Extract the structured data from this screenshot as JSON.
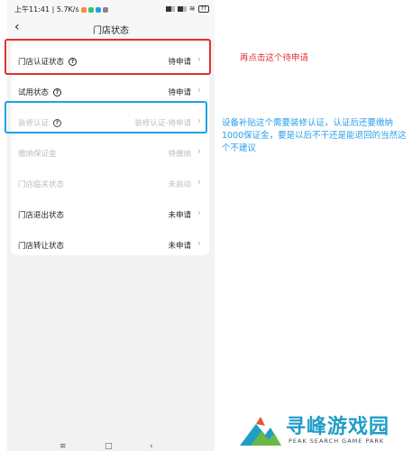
{
  "statusbar": {
    "time_speed": "上午11:41 | 5.7K/s",
    "battery": "77"
  },
  "navbar": {
    "back_glyph": "‹",
    "title": "门店状态"
  },
  "rows": [
    {
      "label": "门店认证状态",
      "value": "待申请",
      "has_help": true,
      "disabled": false
    },
    {
      "label": "试用状态",
      "value": "待申请",
      "has_help": true,
      "disabled": false
    },
    {
      "label": "装修认证",
      "value": "装修认证-待申请",
      "has_help": true,
      "disabled": true
    },
    {
      "label": "缴纳保证金",
      "value": "待缴纳",
      "has_help": false,
      "disabled": true
    },
    {
      "label": "门店临关状态",
      "value": "未启动",
      "has_help": false,
      "disabled": true
    },
    {
      "label": "门店退出状态",
      "value": "未申请",
      "has_help": false,
      "disabled": false
    },
    {
      "label": "门店转让状态",
      "value": "未申请",
      "has_help": false,
      "disabled": false
    }
  ],
  "annotations": {
    "red": "再点击这个待申请",
    "blue": "设备补贴这个需要装修认证，认证后还要缴纳1000保证金，要是以后不干还是能退回的当然这个不建议"
  },
  "logo": {
    "cn": "寻峰游戏园",
    "en": "PEAK SEARCH GAME PARK"
  },
  "colors": {
    "red": "#e03030",
    "blue": "#1aa3e8",
    "logo": "#1f9ec8"
  }
}
